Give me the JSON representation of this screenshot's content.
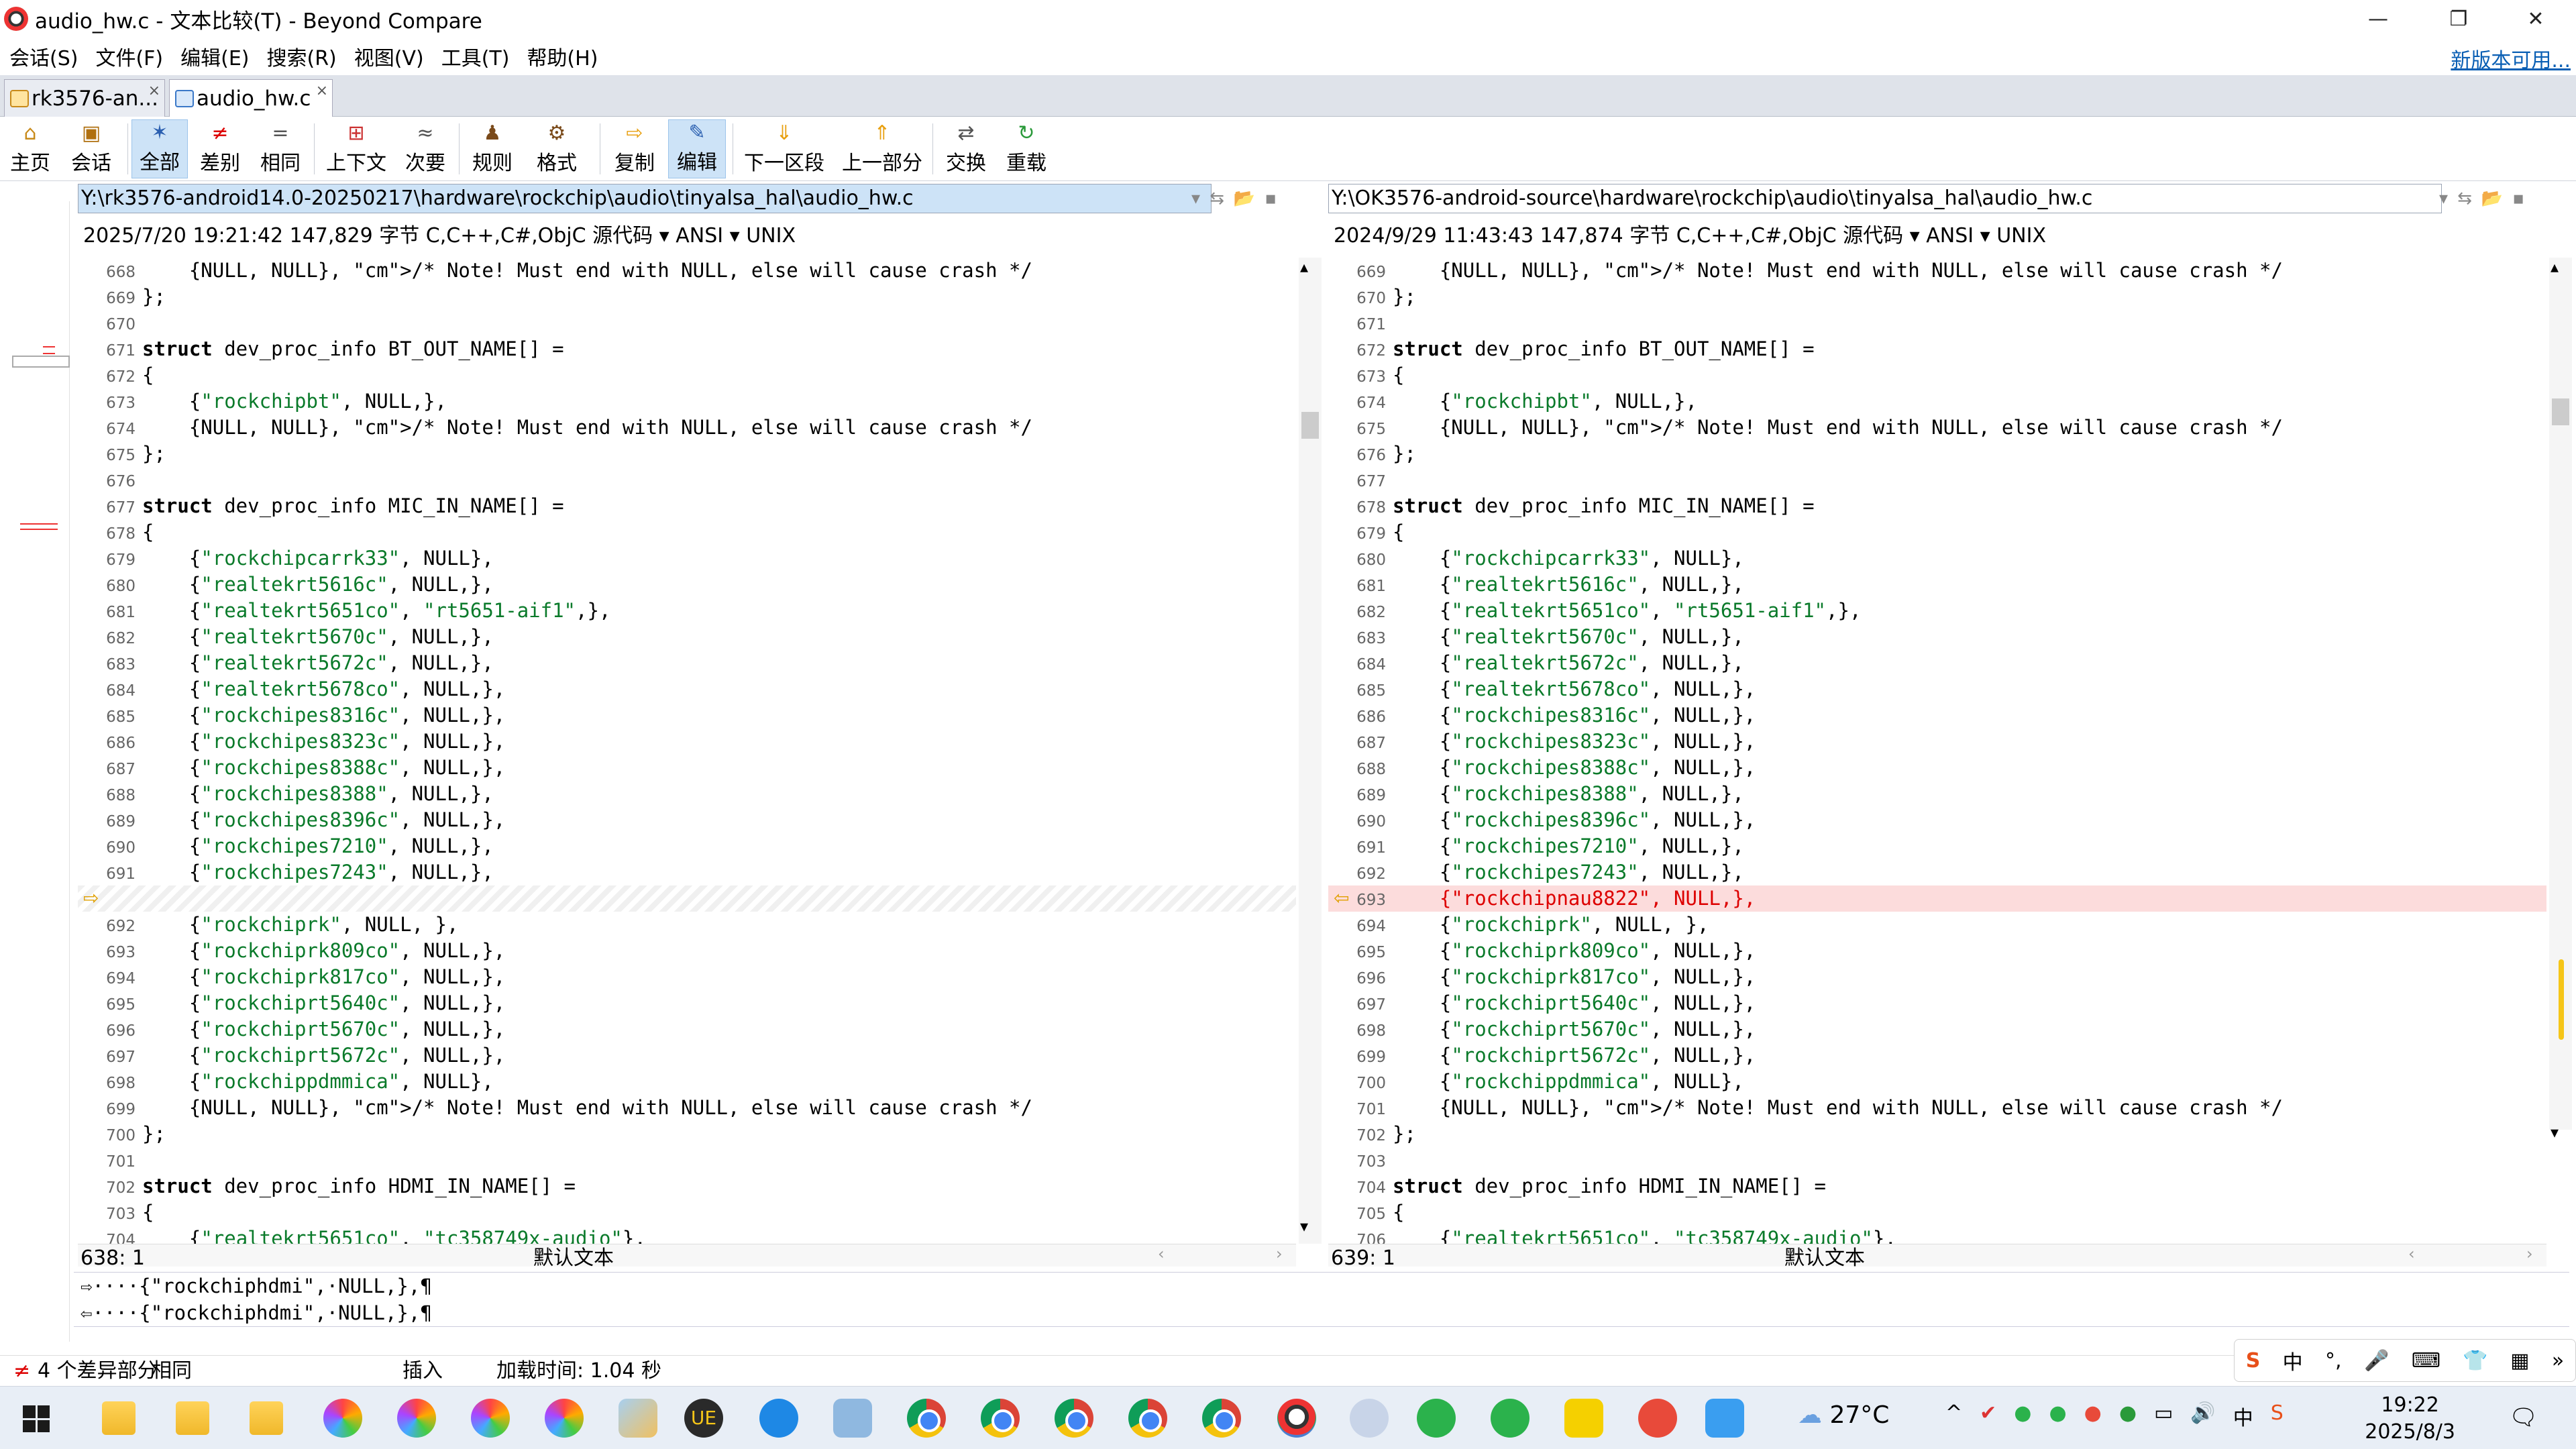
{
  "window": {
    "title": "audio_hw.c - 文本比较(T) - Beyond Compare",
    "minimize": "—",
    "restore": "❐",
    "close": "✕"
  },
  "menu": {
    "items": [
      "会话(S)",
      "文件(F)",
      "编辑(E)",
      "搜索(R)",
      "视图(V)",
      "工具(T)",
      "帮助(H)"
    ],
    "new_version": "新版本可用..."
  },
  "tabs": [
    {
      "label": "rk3576-an...",
      "close": "×"
    },
    {
      "label": "audio_hw.c",
      "close": "×"
    }
  ],
  "toolbar": [
    {
      "label": "主页",
      "icon": "⌂"
    },
    {
      "label": "会话",
      "icon": "▣"
    },
    {
      "label": "全部",
      "icon": "✶",
      "active": true
    },
    {
      "label": "差别",
      "icon": "≠"
    },
    {
      "label": "相同",
      "icon": "="
    },
    {
      "label": "上下文",
      "icon": "⊞"
    },
    {
      "label": "次要",
      "icon": "≈"
    },
    {
      "label": "规则",
      "icon": "♟"
    },
    {
      "label": "格式",
      "icon": "⚙"
    },
    {
      "label": "复制",
      "icon": "⇨"
    },
    {
      "label": "编辑",
      "icon": "✎",
      "active": true
    },
    {
      "label": "下一区段",
      "icon": "⇓"
    },
    {
      "label": "上一部分",
      "icon": "⇑"
    },
    {
      "label": "交换",
      "icon": "⇄"
    },
    {
      "label": "重载",
      "icon": "↻"
    }
  ],
  "left": {
    "path": "Y:\\rk3576-android14.0-20250217\\hardware\\rockchip\\audio\\tinyalsa_hal\\audio_hw.c",
    "info": "2025/7/20 19:21:42  147,829 字节  C,C++,C#,ObjC 源代码 ▾ ANSI ▾ UNIX",
    "cursor": "638: 1",
    "mode": "默认文本",
    "lines": [
      {
        "n": "668",
        "t": "    {NULL, NULL}, /* Note! Must end with NULL, else will cause crash */"
      },
      {
        "n": "669",
        "t": "};"
      },
      {
        "n": "670",
        "t": ""
      },
      {
        "n": "671",
        "t": "struct dev_proc_info BT_OUT_NAME[] ="
      },
      {
        "n": "672",
        "t": "{"
      },
      {
        "n": "673",
        "t": "    {\"rockchipbt\", NULL,},"
      },
      {
        "n": "674",
        "t": "    {NULL, NULL}, /* Note! Must end with NULL, else will cause crash */"
      },
      {
        "n": "675",
        "t": "};"
      },
      {
        "n": "676",
        "t": ""
      },
      {
        "n": "677",
        "t": "struct dev_proc_info MIC_IN_NAME[] ="
      },
      {
        "n": "678",
        "t": "{"
      },
      {
        "n": "679",
        "t": "    {\"rockchipcarrk33\", NULL},"
      },
      {
        "n": "680",
        "t": "    {\"realtekrt5616c\", NULL,},"
      },
      {
        "n": "681",
        "t": "    {\"realtekrt5651co\", \"rt5651-aif1\",},"
      },
      {
        "n": "682",
        "t": "    {\"realtekrt5670c\", NULL,},"
      },
      {
        "n": "683",
        "t": "    {\"realtekrt5672c\", NULL,},"
      },
      {
        "n": "684",
        "t": "    {\"realtekrt5678co\", NULL,},"
      },
      {
        "n": "685",
        "t": "    {\"rockchipes8316c\", NULL,},"
      },
      {
        "n": "686",
        "t": "    {\"rockchipes8323c\", NULL,},"
      },
      {
        "n": "687",
        "t": "    {\"rockchipes8388c\", NULL,},"
      },
      {
        "n": "688",
        "t": "    {\"rockchipes8388\", NULL,},"
      },
      {
        "n": "689",
        "t": "    {\"rockchipes8396c\", NULL,},"
      },
      {
        "n": "690",
        "t": "    {\"rockchipes7210\", NULL,},"
      },
      {
        "n": "691",
        "t": "    {\"rockchipes7243\", NULL,},"
      },
      {
        "n": "",
        "t": "",
        "gap": true
      },
      {
        "n": "692",
        "t": "    {\"rockchiprk\", NULL, },"
      },
      {
        "n": "693",
        "t": "    {\"rockchiprk809co\", NULL,},"
      },
      {
        "n": "694",
        "t": "    {\"rockchiprk817co\", NULL,},"
      },
      {
        "n": "695",
        "t": "    {\"rockchiprt5640c\", NULL,},"
      },
      {
        "n": "696",
        "t": "    {\"rockchiprt5670c\", NULL,},"
      },
      {
        "n": "697",
        "t": "    {\"rockchiprt5672c\", NULL,},"
      },
      {
        "n": "698",
        "t": "    {\"rockchippdmmica\", NULL},"
      },
      {
        "n": "699",
        "t": "    {NULL, NULL}, /* Note! Must end with NULL, else will cause crash */"
      },
      {
        "n": "700",
        "t": "};"
      },
      {
        "n": "701",
        "t": ""
      },
      {
        "n": "702",
        "t": "struct dev_proc_info HDMI_IN_NAME[] ="
      },
      {
        "n": "703",
        "t": "{"
      },
      {
        "n": "704",
        "t": "    {\"realtekrt5651co\", \"tc358749x-audio\"},"
      }
    ]
  },
  "right": {
    "path": "Y:\\OK3576-android-source\\hardware\\rockchip\\audio\\tinyalsa_hal\\audio_hw.c",
    "info": "2024/9/29 11:43:43  147,874 字节  C,C++,C#,ObjC 源代码 ▾ ANSI ▾ UNIX",
    "cursor": "639: 1",
    "mode": "默认文本",
    "lines": [
      {
        "n": "669",
        "t": "    {NULL, NULL}, /* Note! Must end with NULL, else will cause crash */"
      },
      {
        "n": "670",
        "t": "};"
      },
      {
        "n": "671",
        "t": ""
      },
      {
        "n": "672",
        "t": "struct dev_proc_info BT_OUT_NAME[] ="
      },
      {
        "n": "673",
        "t": "{"
      },
      {
        "n": "674",
        "t": "    {\"rockchipbt\", NULL,},"
      },
      {
        "n": "675",
        "t": "    {NULL, NULL}, /* Note! Must end with NULL, else will cause crash */"
      },
      {
        "n": "676",
        "t": "};"
      },
      {
        "n": "677",
        "t": ""
      },
      {
        "n": "678",
        "t": "struct dev_proc_info MIC_IN_NAME[] ="
      },
      {
        "n": "679",
        "t": "{"
      },
      {
        "n": "680",
        "t": "    {\"rockchipcarrk33\", NULL},"
      },
      {
        "n": "681",
        "t": "    {\"realtekrt5616c\", NULL,},"
      },
      {
        "n": "682",
        "t": "    {\"realtekrt5651co\", \"rt5651-aif1\",},"
      },
      {
        "n": "683",
        "t": "    {\"realtekrt5670c\", NULL,},"
      },
      {
        "n": "684",
        "t": "    {\"realtekrt5672c\", NULL,},"
      },
      {
        "n": "685",
        "t": "    {\"realtekrt5678co\", NULL,},"
      },
      {
        "n": "686",
        "t": "    {\"rockchipes8316c\", NULL,},"
      },
      {
        "n": "687",
        "t": "    {\"rockchipes8323c\", NULL,},"
      },
      {
        "n": "688",
        "t": "    {\"rockchipes8388c\", NULL,},"
      },
      {
        "n": "689",
        "t": "    {\"rockchipes8388\", NULL,},"
      },
      {
        "n": "690",
        "t": "    {\"rockchipes8396c\", NULL,},"
      },
      {
        "n": "691",
        "t": "    {\"rockchipes7210\", NULL,},"
      },
      {
        "n": "692",
        "t": "    {\"rockchipes7243\", NULL,},"
      },
      {
        "n": "693",
        "t": "    {\"rockchipnau8822\", NULL,},",
        "diff": true
      },
      {
        "n": "694",
        "t": "    {\"rockchiprk\", NULL, },"
      },
      {
        "n": "695",
        "t": "    {\"rockchiprk809co\", NULL,},"
      },
      {
        "n": "696",
        "t": "    {\"rockchiprk817co\", NULL,},"
      },
      {
        "n": "697",
        "t": "    {\"rockchiprt5640c\", NULL,},"
      },
      {
        "n": "698",
        "t": "    {\"rockchiprt5670c\", NULL,},"
      },
      {
        "n": "699",
        "t": "    {\"rockchiprt5672c\", NULL,},"
      },
      {
        "n": "700",
        "t": "    {\"rockchippdmmica\", NULL},"
      },
      {
        "n": "701",
        "t": "    {NULL, NULL}, /* Note! Must end with NULL, else will cause crash */"
      },
      {
        "n": "702",
        "t": "};"
      },
      {
        "n": "703",
        "t": ""
      },
      {
        "n": "704",
        "t": "struct dev_proc_info HDMI_IN_NAME[] ="
      },
      {
        "n": "705",
        "t": "{"
      },
      {
        "n": "706",
        "t": "    {\"realtekrt5651co\", \"tc358749x-audio\"},"
      }
    ]
  },
  "compare_lines": [
    "⇨····{\"rockchiphdmi\",·NULL,},¶",
    "⇦····{\"rockchiphdmi\",·NULL,},¶"
  ],
  "status": {
    "diff_count": "4 个差异部分",
    "diff_type": "相同",
    "mode": "插入",
    "load_time": "加载时间: 1.04 秒"
  },
  "taskbar": {
    "weather": "27°C",
    "time": "19:22",
    "date": "2025/8/3",
    "ime_lang": "中"
  }
}
